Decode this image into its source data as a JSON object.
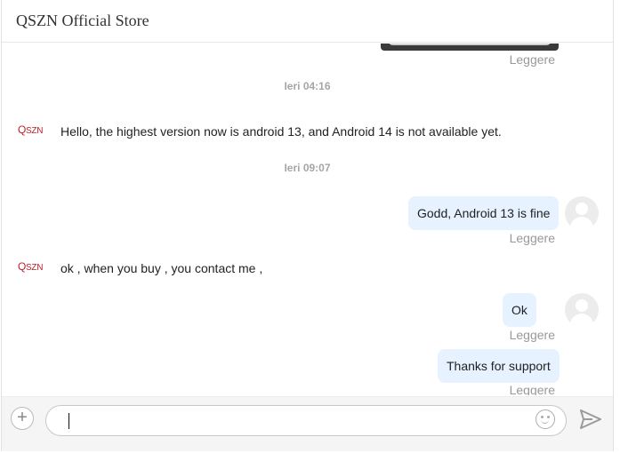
{
  "header": {
    "title": "QSZN Official Store"
  },
  "thread": {
    "read_label": "Leggere",
    "logo": {
      "q": "Q",
      "rest": "SZN"
    },
    "timestamps": [
      "Ieri 04:16",
      "Ieri 09:07"
    ],
    "messages": [
      {
        "from": "store",
        "text": "Hello, the highest version now is android 13, and Android 14 is not available yet."
      },
      {
        "from": "user",
        "text": "Godd, Android 13 is fine"
      },
      {
        "from": "store",
        "text": "ok , when you buy , you contact me ,"
      },
      {
        "from": "user",
        "text": "Ok"
      },
      {
        "from": "user",
        "text": "Thanks for support"
      }
    ]
  },
  "composer": {
    "placeholder": "",
    "value": ""
  },
  "colors": {
    "accent": "#e6f2ff",
    "logo": "#c0202a"
  }
}
